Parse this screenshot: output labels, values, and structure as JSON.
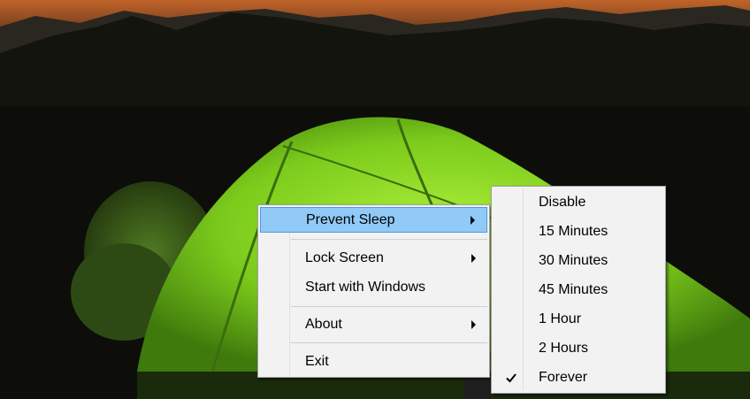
{
  "context_menu": {
    "items": [
      {
        "label": "Prevent Sleep",
        "has_submenu": true,
        "highlighted": true
      },
      {
        "label": "Lock Screen",
        "has_submenu": true
      },
      {
        "label": "Start with Windows",
        "has_submenu": false
      },
      {
        "label": "About",
        "has_submenu": true
      },
      {
        "label": "Exit",
        "has_submenu": false
      }
    ]
  },
  "prevent_sleep_submenu": {
    "items": [
      {
        "label": "Disable"
      },
      {
        "label": "15 Minutes"
      },
      {
        "label": "30 Minutes"
      },
      {
        "label": "45 Minutes"
      },
      {
        "label": "1 Hour"
      },
      {
        "label": "2 Hours"
      },
      {
        "label": "Forever",
        "checked": true
      }
    ]
  },
  "colors": {
    "highlight_fill": "#91c9f7",
    "highlight_border": "#4f9bdc",
    "menu_background": "#f2f2f2"
  },
  "icons": {
    "submenu_arrow": "chevron-right-icon",
    "checked": "check-icon"
  }
}
